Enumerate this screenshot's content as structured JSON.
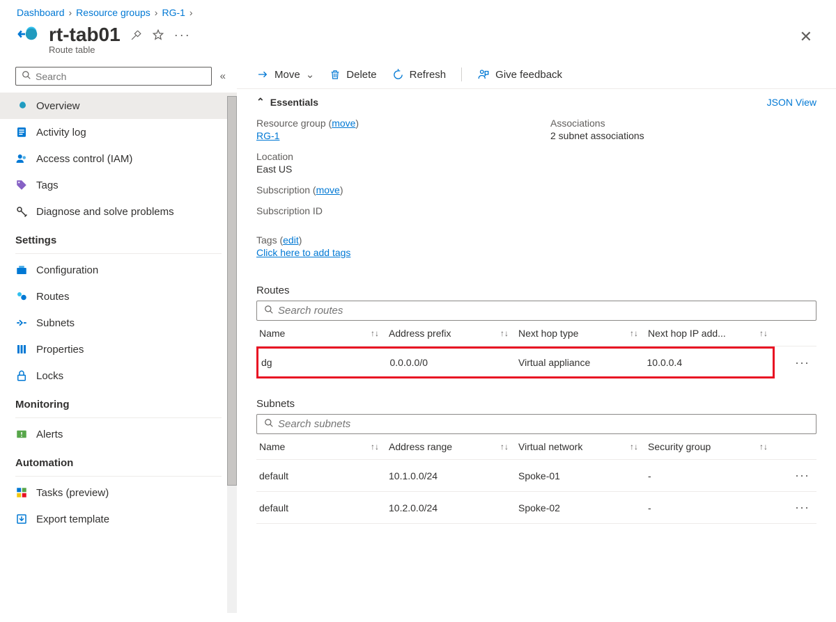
{
  "breadcrumb": [
    {
      "label": "Dashboard"
    },
    {
      "label": "Resource groups"
    },
    {
      "label": "RG-1"
    }
  ],
  "header": {
    "title": "rt-tab01",
    "subtitle": "Route table"
  },
  "sidebar": {
    "search_placeholder": "Search",
    "items": [
      {
        "label": "Overview"
      },
      {
        "label": "Activity log"
      },
      {
        "label": "Access control (IAM)"
      },
      {
        "label": "Tags"
      },
      {
        "label": "Diagnose and solve problems"
      }
    ],
    "sections": [
      {
        "title": "Settings",
        "items": [
          {
            "label": "Configuration"
          },
          {
            "label": "Routes"
          },
          {
            "label": "Subnets"
          },
          {
            "label": "Properties"
          },
          {
            "label": "Locks"
          }
        ]
      },
      {
        "title": "Monitoring",
        "items": [
          {
            "label": "Alerts"
          }
        ]
      },
      {
        "title": "Automation",
        "items": [
          {
            "label": "Tasks (preview)"
          },
          {
            "label": "Export template"
          }
        ]
      }
    ]
  },
  "cmdbar": {
    "move": "Move",
    "delete": "Delete",
    "refresh": "Refresh",
    "feedback": "Give feedback"
  },
  "essentials": {
    "label": "Essentials",
    "json_view": "JSON View",
    "resource_group_label": "Resource group",
    "resource_group_move": "move",
    "resource_group_value": "RG-1",
    "location_label": "Location",
    "location_value": "East US",
    "subscription_label": "Subscription",
    "subscription_move": "move",
    "subscription_id_label": "Subscription ID",
    "associations_label": "Associations",
    "associations_value": "2 subnet associations",
    "tags_label": "Tags",
    "tags_edit": "edit",
    "tags_add": "Click here to add tags"
  },
  "routes": {
    "title": "Routes",
    "search_placeholder": "Search routes",
    "columns": [
      "Name",
      "Address prefix",
      "Next hop type",
      "Next hop IP add..."
    ],
    "rows": [
      {
        "name": "dg",
        "prefix": "0.0.0.0/0",
        "hop_type": "Virtual appliance",
        "hop_ip": "10.0.0.4",
        "hl": true
      }
    ]
  },
  "subnets": {
    "title": "Subnets",
    "search_placeholder": "Search subnets",
    "columns": [
      "Name",
      "Address range",
      "Virtual network",
      "Security group"
    ],
    "rows": [
      {
        "name": "default",
        "range": "10.1.0.0/24",
        "vnet": "Spoke-01",
        "sg": "-"
      },
      {
        "name": "default",
        "range": "10.2.0.0/24",
        "vnet": "Spoke-02",
        "sg": "-"
      }
    ]
  }
}
